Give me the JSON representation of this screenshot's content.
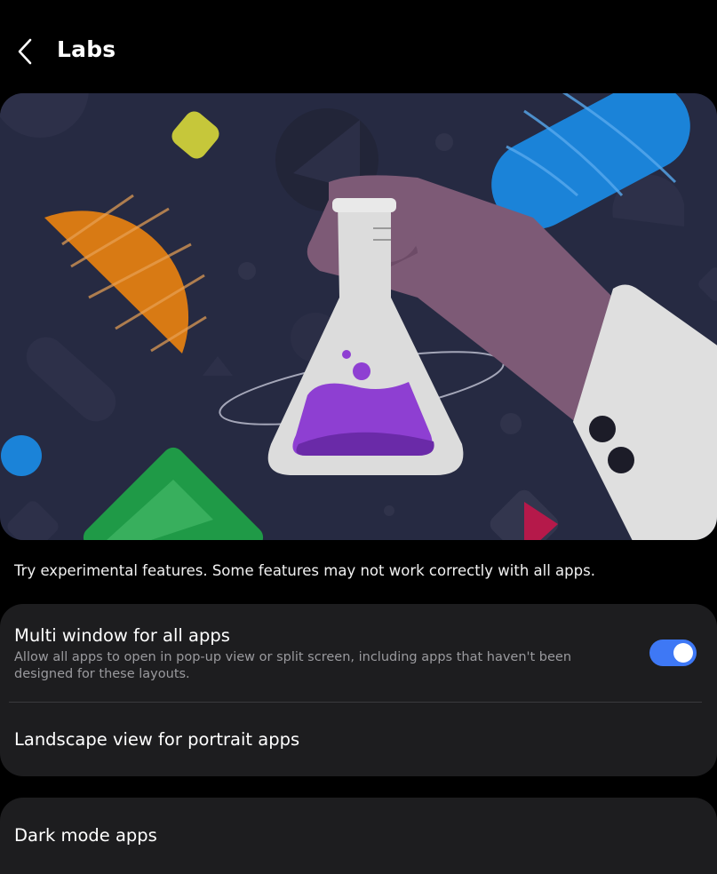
{
  "header": {
    "title": "Labs",
    "back_icon": "chevron-left-icon"
  },
  "banner": {
    "illustration": "hand-holding-flask-illustration"
  },
  "description": "Try experimental features. Some features may not work correctly with all apps.",
  "settings": [
    {
      "title": "Multi window for all apps",
      "subtitle": "Allow all apps to open in pop-up view or split screen, including apps that haven't been designed for these layouts.",
      "toggle_on": true
    },
    {
      "title": "Landscape view for portrait apps"
    },
    {
      "title": "Dark mode apps"
    }
  ],
  "colors": {
    "background": "#000000",
    "card": "#1d1d1f",
    "toggle_on": "#3e78f5",
    "subtitle": "#9a9a9e",
    "banner_bg": "#262a42"
  }
}
